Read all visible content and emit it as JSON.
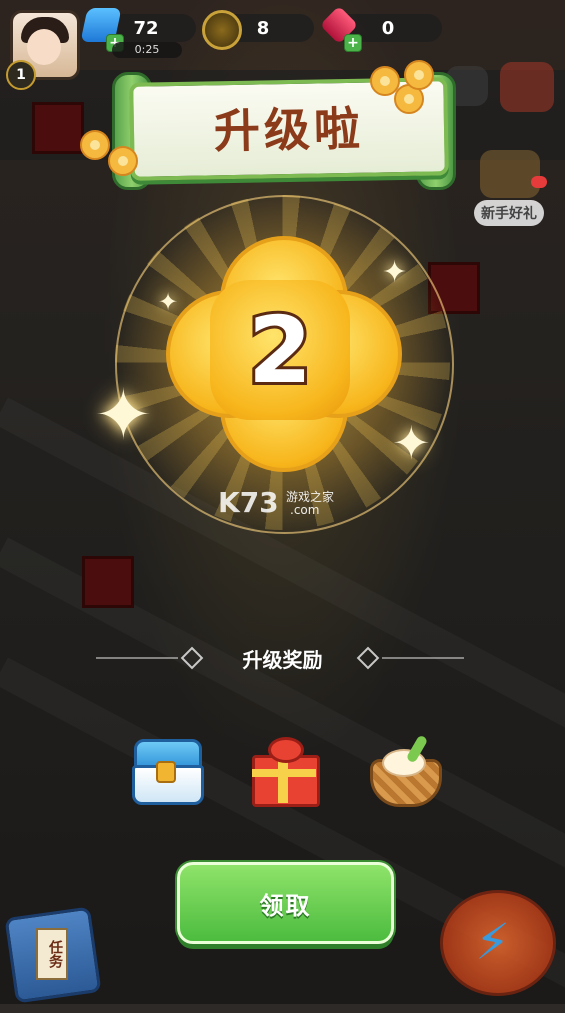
{
  "hud": {
    "energy_value": "72",
    "energy_timer": "0:25",
    "coin_value": "8",
    "gem_value": "0",
    "player_level": "1",
    "plus_symbol": "+"
  },
  "banner": {
    "title": "升级啦"
  },
  "level_up": {
    "new_level": "2"
  },
  "watermark": {
    "logo": "K73",
    "site_name": "游戏之家",
    "domain": ".com"
  },
  "rewards": {
    "section_title": "升级奖励",
    "items": [
      {
        "icon": "treasure-chest-icon"
      },
      {
        "icon": "gift-box-icon"
      },
      {
        "icon": "food-basket-icon"
      }
    ]
  },
  "claim_button": {
    "label": "领取"
  },
  "side": {
    "newbie_gift_label": "新手好礼",
    "task_label": "任务"
  },
  "colors": {
    "accent_green": "#4cbc3f",
    "gold": "#f7b51b",
    "banner_text": "#8c3b1a"
  }
}
